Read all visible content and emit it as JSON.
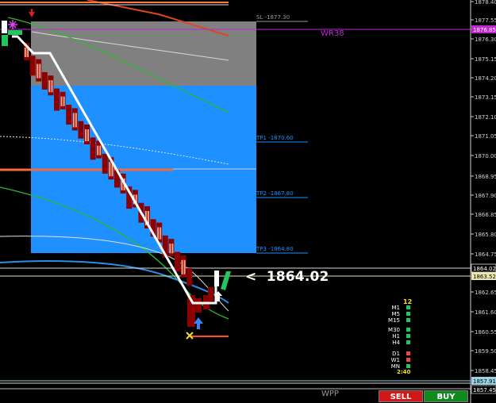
{
  "chart": {
    "bid_price": "1864.02",
    "bid_marker": "<",
    "price_axis": [
      "1878.40",
      "1877.55",
      "1876.30",
      "1875.15",
      "1874.20",
      "1873.15",
      "1872.10",
      "1871.05",
      "1870.00",
      "1868.95",
      "1867.90",
      "1866.85",
      "1865.80",
      "1864.75",
      "1862.65",
      "1861.60",
      "1860.55",
      "1859.50",
      "1858.45",
      "1857.45"
    ],
    "price_tags": {
      "wr_level": "1876.85",
      "ask": "1864.02",
      "bid": "1863.52",
      "low_level": "1857.91",
      "bottom": "1857.45"
    },
    "levels": {
      "sl": "SL -1877.30",
      "tp1": "TP1 -1870.60",
      "tp2": "TP2 -1867.80",
      "tp3": "TP3 -1864.80"
    },
    "wr_label": "WR38",
    "wpp_label": "WPP"
  },
  "timeframes": {
    "spread": "12",
    "rows": [
      {
        "label": "M1",
        "color": "#22c55e"
      },
      {
        "label": "M5",
        "color": "#22c55e"
      },
      {
        "label": "M15",
        "color": "#22c55e"
      },
      {
        "label": "M30",
        "color": "#22c55e"
      },
      {
        "label": "H1",
        "color": "#22c55e"
      },
      {
        "label": "H4",
        "color": "#22c55e"
      },
      {
        "label": "D1",
        "color": "#ef4444"
      },
      {
        "label": "W1",
        "color": "#ef4444"
      },
      {
        "label": "MN",
        "color": "#22c55e"
      }
    ],
    "timer": "2:40"
  },
  "trade": {
    "sell_label": "SELL",
    "buy_label": "BUY"
  },
  "colors": {
    "sell": "#d01818",
    "buy": "#0f8a1d",
    "tp_zone": "#1e90ff",
    "sl_zone": "#808080"
  }
}
